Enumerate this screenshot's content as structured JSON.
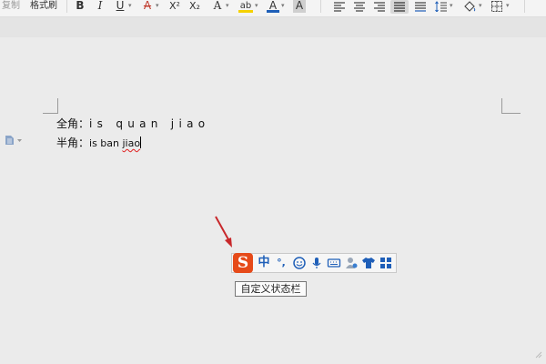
{
  "toolbar": {
    "copy_label": "复制",
    "format_painter_label": "格式刷",
    "bold_label": "B",
    "italic_label": "I",
    "underline_label": "U",
    "strike_label": "A",
    "superscript_label": "X²",
    "subscript_label": "X₂",
    "text_effect_label": "A",
    "highlight_label": "ab",
    "font_color_label": "A",
    "char_shading_label": "A"
  },
  "document": {
    "line1_label": "全角：",
    "line1_text": "is quan jiao",
    "line2_label": "半角：",
    "line2_text": "is ban ",
    "line2_misspelled": "jiao"
  },
  "ime_bar": {
    "logo": "S",
    "mode_label": "中",
    "punctuation_label": "°,",
    "tooltip": "自定义状态栏"
  },
  "colors": {
    "accent_red": "#e64a19",
    "ime_blue": "#1f5fb8",
    "arrow_red": "#c8282b"
  }
}
